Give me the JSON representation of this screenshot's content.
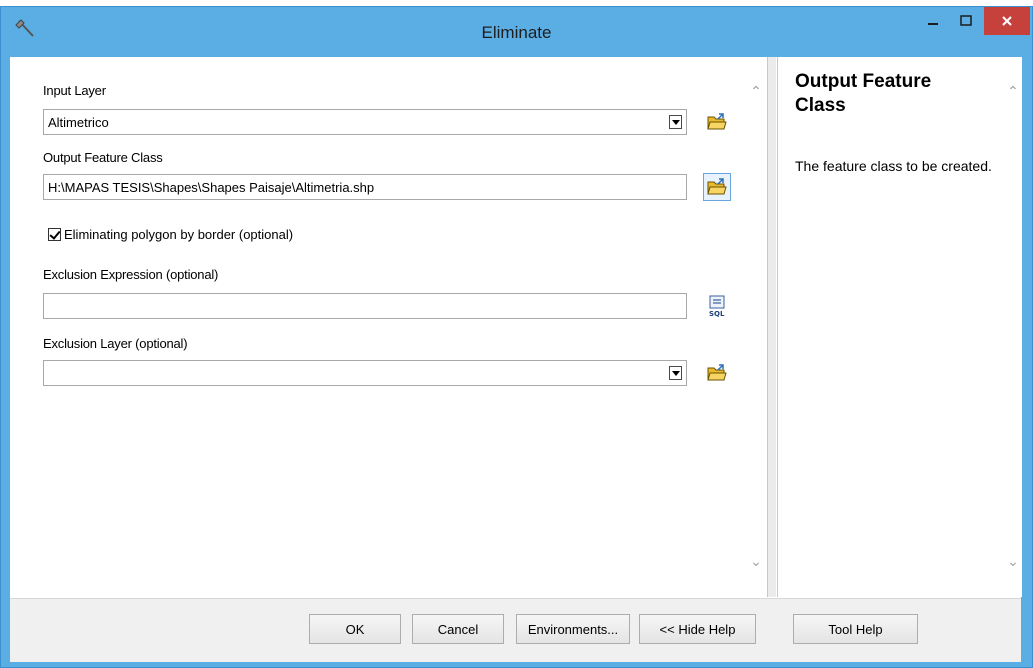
{
  "window": {
    "title": "Eliminate"
  },
  "params": {
    "input_layer": {
      "label": "Input Layer",
      "value": "Altimetrico"
    },
    "output_feature_class": {
      "label": "Output Feature Class",
      "value": "H:\\MAPAS TESIS\\Shapes\\Shapes Paisaje\\Altimetria.shp"
    },
    "eliminating_polygon": {
      "label": "Eliminating polygon by border (optional)",
      "checked": true
    },
    "exclusion_expression": {
      "label": "Exclusion Expression (optional)",
      "value": ""
    },
    "exclusion_layer": {
      "label": "Exclusion Layer (optional)",
      "value": ""
    }
  },
  "help": {
    "title": "Output Feature Class",
    "body": "The feature class to be created."
  },
  "footer": {
    "ok": "OK",
    "cancel": "Cancel",
    "environments": "Environments...",
    "hide_help": "<< Hide Help",
    "tool_help": "Tool Help"
  },
  "icons": {
    "app": "hammer-icon",
    "minimize": "minimize-icon",
    "maximize": "maximize-icon",
    "close": "close-icon",
    "browse": "open-folder-icon",
    "sql": "sql-icon"
  },
  "colors": {
    "titlebar": "#5aaee4",
    "close_button": "#c7413c"
  }
}
